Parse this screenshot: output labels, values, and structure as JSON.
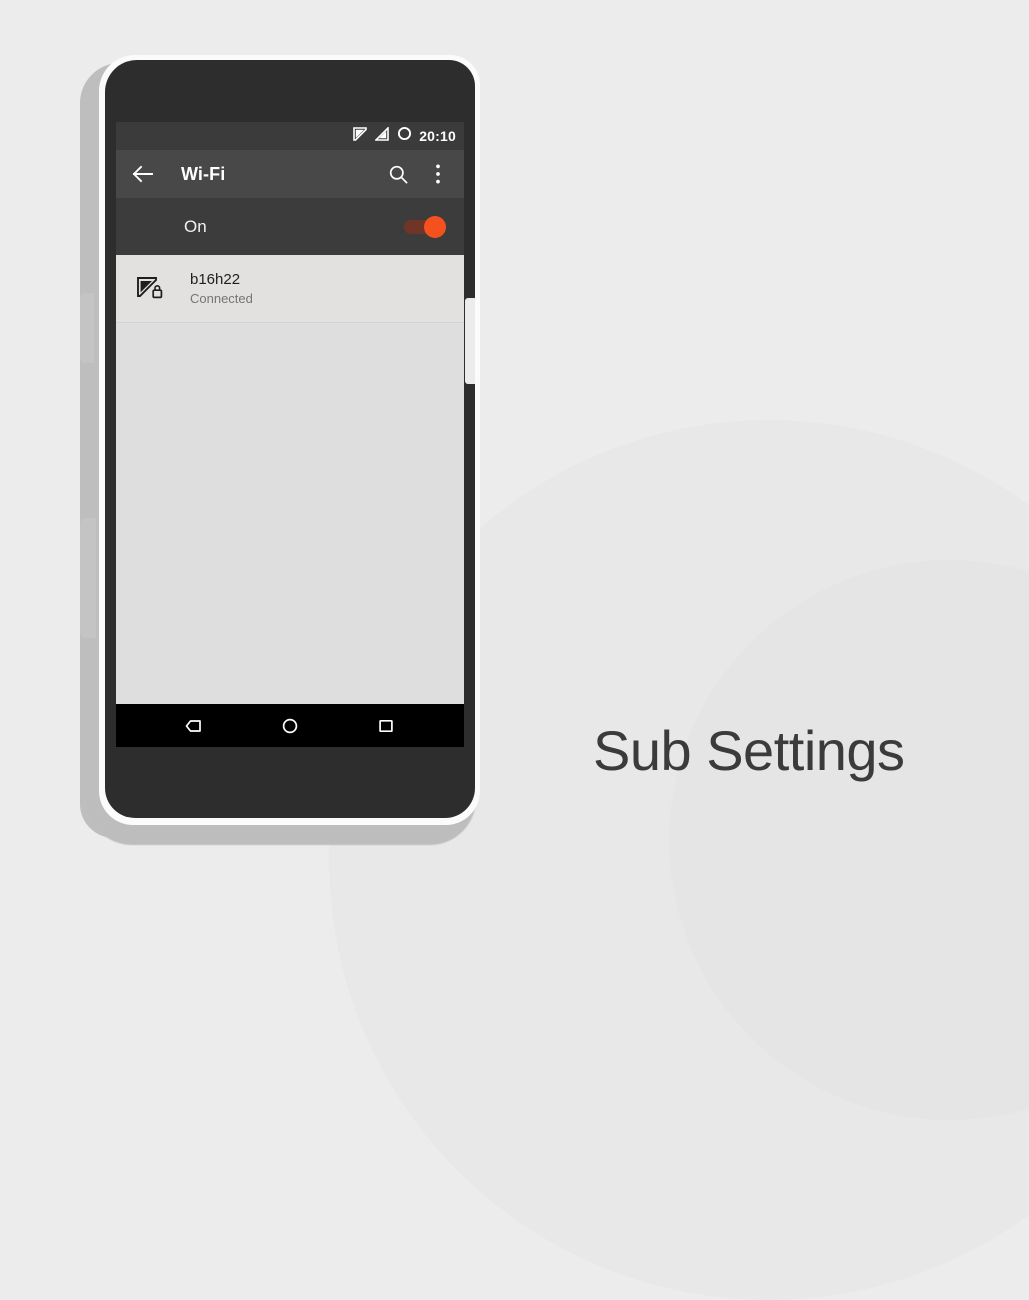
{
  "caption": "Sub Settings",
  "background": {
    "page_color": "#ececec",
    "circle_outer_color": "#e8e8e8",
    "circle_inner_color": "#e5e5e5"
  },
  "device": {
    "body_color": "#2d2d2d",
    "rim_color": "#fbfbfb",
    "backplate_color": "#bebebe"
  },
  "screen": {
    "statusbar": {
      "background": "#3b3b3b",
      "clock": "20:10",
      "icons": [
        {
          "name": "wifi-off-icon",
          "label": "wifi"
        },
        {
          "name": "signal-cellular-icon",
          "label": "signal"
        },
        {
          "name": "battery-circle-icon",
          "label": "battery"
        }
      ]
    },
    "toolbar": {
      "background": "#484848",
      "title": "Wi-Fi",
      "back_icon": "arrow-back-icon",
      "search_icon": "search-icon",
      "overflow_icon": "more-vert-icon"
    },
    "master_switch": {
      "background": "#3c3c3c",
      "label": "On",
      "checked": true,
      "track_color": "#6f3527",
      "thumb_color": "#f4511e"
    },
    "networks": [
      {
        "ssid": "b16h22",
        "status": "Connected",
        "secured": true,
        "signal_icon": "wifi-lock-icon"
      }
    ],
    "content_background": "#dedede",
    "navbar": {
      "background": "#000000",
      "buttons": [
        {
          "name": "nav-back-button",
          "label": "Back"
        },
        {
          "name": "nav-home-button",
          "label": "Home"
        },
        {
          "name": "nav-recents-button",
          "label": "Recents"
        }
      ]
    }
  }
}
